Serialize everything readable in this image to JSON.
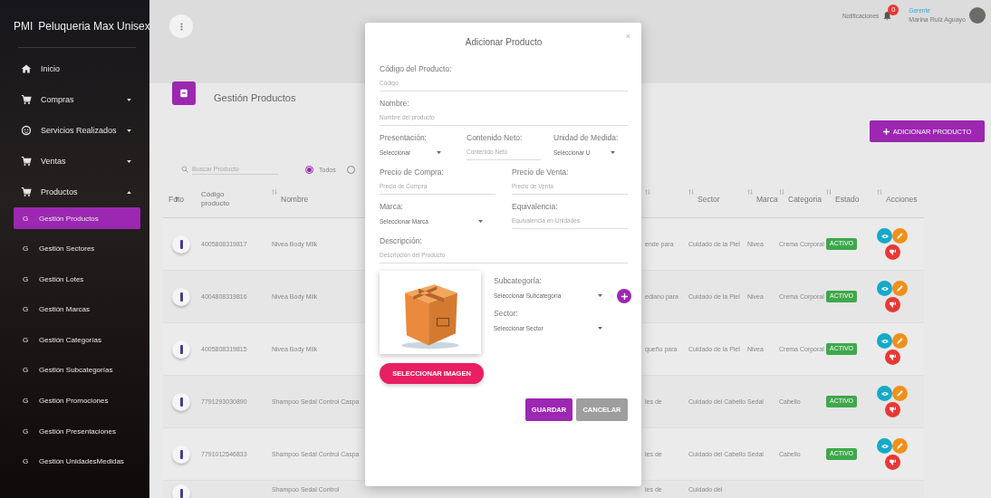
{
  "sidebar": {
    "logo": "PMI",
    "title": "Peluqueria Max Unisex",
    "items": [
      {
        "label": "Inicio"
      },
      {
        "label": "Compras",
        "expanded": false
      },
      {
        "label": "Servicios Realizados",
        "expanded": false
      },
      {
        "label": "Ventas",
        "expanded": false
      },
      {
        "label": "Productos",
        "expanded": true,
        "children": [
          {
            "letter": "G",
            "label": "Gestión Productos",
            "selected": true
          },
          {
            "letter": "G",
            "label": "Gestión Sectores",
            "selected": false
          },
          {
            "letter": "G",
            "label": "Gestión Lotes",
            "selected": false
          },
          {
            "letter": "G",
            "label": "Gestión Marcas",
            "selected": false
          },
          {
            "letter": "G",
            "label": "Gestión Categorías",
            "selected": false
          },
          {
            "letter": "G",
            "label": "Gestión Subcategorías",
            "selected": false
          },
          {
            "letter": "G",
            "label": "Gestión Promociones",
            "selected": false
          },
          {
            "letter": "G",
            "label": "Gestión Presentaciones",
            "selected": false
          },
          {
            "letter": "G",
            "label": "Gestión UnidadesMedidas",
            "selected": false
          }
        ]
      }
    ]
  },
  "header": {
    "notifications": {
      "label": "Notificaciones",
      "count": "0"
    },
    "user": {
      "role": "Gerente",
      "name": "Marina Ruiz Aguayo"
    }
  },
  "page": {
    "title": "Gestión Productos",
    "add_button": "ADICIONAR PRODUCTO",
    "search": {
      "placeholder": "Buscar Producto"
    },
    "filters": [
      {
        "label": "Todos",
        "selected": true
      },
      {
        "selected": false
      }
    ]
  },
  "table": {
    "columns": [
      "Foto",
      "Código producto",
      "Nombre",
      "Sector",
      "Marca",
      "Categoria",
      "Estado",
      "Acciones"
    ],
    "rows": [
      {
        "codigo": "4005808319817",
        "nombre": "Nivea Body Milk",
        "column_4": "ende para",
        "sector": "Cuidado de la Piel",
        "marca": "Nivea",
        "categoria": "Crema Corporal",
        "estado": "ACTIVO"
      },
      {
        "codigo": "4004808319816",
        "nombre": "Nivea Body Milk",
        "column_4": "ediano para",
        "sector": "Cuidado de la Piel",
        "marca": "Nivea",
        "categoria": "Crema Corporal",
        "estado": "ACTIVO"
      },
      {
        "codigo": "4005808319815",
        "nombre": "Nivea Body Milk",
        "column_4": "queño para",
        "sector": "Cuidado de la Piel",
        "marca": "Nivea",
        "categoria": "Crema Corporal",
        "estado": "ACTIVO"
      },
      {
        "codigo": "7791293030890",
        "nombre": "Shampoo Sedal Control Caspa",
        "column_4": "les de",
        "sector": "Cuidado del Cabello",
        "marca": "Sedal",
        "categoria": "Cabello",
        "estado": "ACTIVO"
      },
      {
        "codigo": "7791012546833",
        "nombre": "Shampoo Sedal Control Caspa",
        "column_4": "les de",
        "sector": "Cuidado del Cabello",
        "marca": "Sedal",
        "categoria": "Cabello",
        "estado": "ACTIVO"
      },
      {
        "nombre": "Shampoo Sedal Control",
        "column_4": "les de",
        "sector": "Cuidado del"
      }
    ]
  },
  "modal": {
    "title": "Adicionar Producto",
    "close": "×",
    "rows": [
      [
        {
          "kind": "input",
          "label": "Código del Producto:",
          "placeholder": "Código"
        }
      ],
      [
        {
          "kind": "input",
          "label": "Nombre:",
          "placeholder": "Nombre del producto"
        }
      ],
      [
        {
          "kind": "select",
          "label": "Presentación:",
          "value": "Seleccionar"
        },
        {
          "kind": "input",
          "label": "Contenido Neto:",
          "placeholder": "Contenido Neto"
        },
        {
          "kind": "select",
          "label": "Unidad de Medida:",
          "value": "Seleccionar U"
        }
      ],
      [
        {
          "kind": "input",
          "label": "Precio de Compra:",
          "placeholder": "Precio de Compra"
        },
        {
          "kind": "input",
          "label": "Precio de Venta:",
          "placeholder": "Precio de Venta"
        }
      ],
      [
        {
          "kind": "select",
          "label": "Marca:",
          "value": "Seleccionar Marca"
        },
        {
          "kind": "input",
          "label": "Equivalencia:",
          "placeholder": "Equivalencia en Unidades"
        }
      ],
      [
        {
          "kind": "input",
          "label": "Descripción:",
          "placeholder": "Descripción del Producto"
        }
      ]
    ],
    "side_fields": [
      {
        "kind": "select",
        "label": "Subcategoría:",
        "value": "Seleccionar Subcategoría",
        "add": true
      },
      {
        "kind": "select",
        "label": "Sector:",
        "value": "Seleccionar Sector",
        "add": false
      }
    ],
    "image_button": "SELECCIONAR IMAGEN",
    "save_button": "GUARDAR",
    "cancel_button": "CANCELAR"
  }
}
